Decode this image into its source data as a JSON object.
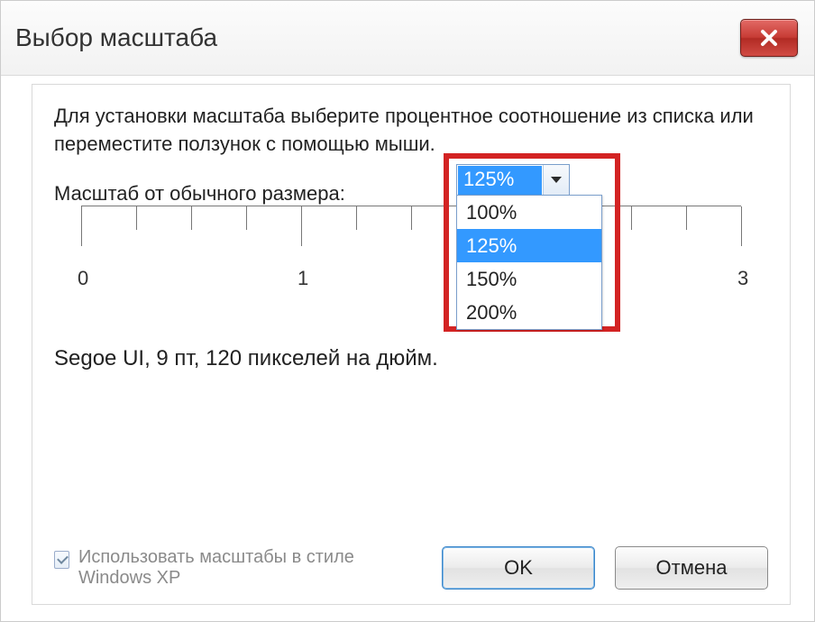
{
  "window": {
    "title": "Выбор масштаба"
  },
  "description": "Для установки масштаба выберите процентное соотношение из списка или переместите ползунок с помощью мыши.",
  "scale": {
    "label": "Масштаб от обычного размера:",
    "selected": "125%",
    "options": [
      "100%",
      "125%",
      "150%",
      "200%"
    ]
  },
  "ruler": {
    "labels": [
      "0",
      "1",
      "3"
    ]
  },
  "preview_text": "Segoe UI, 9 пт, 120 пикселей на дюйм.",
  "checkbox": {
    "label": "Использовать масштабы в стиле Windows XP",
    "checked": true
  },
  "buttons": {
    "ok": "OK",
    "cancel": "Отмена"
  }
}
